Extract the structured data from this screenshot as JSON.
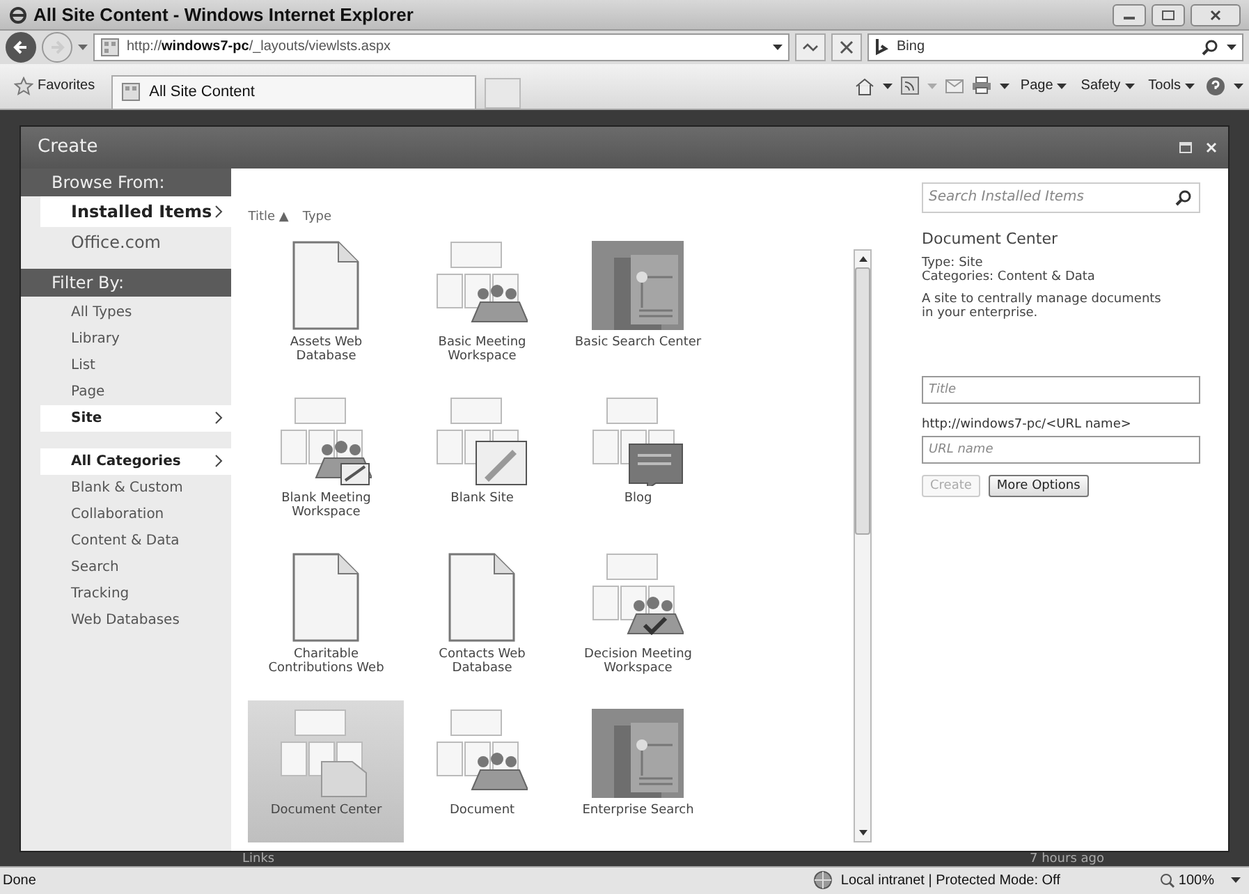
{
  "window": {
    "title": "All Site Content - Windows Internet Explorer"
  },
  "address_bar": {
    "url_prefix": "http://",
    "url_host": "windows7-pc",
    "url_path": "/_layouts/viewlsts.aspx",
    "search_value": "Bing"
  },
  "favorites_bar": {
    "favorites": "Favorites",
    "tab": "All Site Content",
    "commands": [
      "Page",
      "Safety",
      "Tools"
    ]
  },
  "dialog": {
    "title": "Create",
    "browse_header": "Browse From:",
    "browse_items": [
      {
        "label": "Installed Items",
        "selected": true
      },
      {
        "label": "Office.com",
        "selected": false
      }
    ],
    "filter_header": "Filter By:",
    "type_filters": [
      {
        "label": "All Types",
        "selected": false
      },
      {
        "label": "Library",
        "selected": false
      },
      {
        "label": "List",
        "selected": false
      },
      {
        "label": "Page",
        "selected": false
      },
      {
        "label": "Site",
        "selected": true
      }
    ],
    "category_filters": [
      {
        "label": "All Categories",
        "selected": true
      },
      {
        "label": "Blank & Custom",
        "selected": false
      },
      {
        "label": "Collaboration",
        "selected": false
      },
      {
        "label": "Content & Data",
        "selected": false
      },
      {
        "label": "Search",
        "selected": false
      },
      {
        "label": "Tracking",
        "selected": false
      },
      {
        "label": "Web Databases",
        "selected": false
      }
    ],
    "sort": {
      "title": "Title",
      "arrow": "▲",
      "type": "Type"
    },
    "items": [
      {
        "label": "Assets Web Database",
        "kind": "page",
        "selected": false
      },
      {
        "label": "Basic Meeting Workspace",
        "kind": "meeting",
        "selected": false
      },
      {
        "label": "Basic Search Center",
        "kind": "search",
        "selected": false
      },
      {
        "label": "Blank Meeting Workspace",
        "kind": "meeting-edit",
        "selected": false
      },
      {
        "label": "Blank Site",
        "kind": "site-edit",
        "selected": false
      },
      {
        "label": "Blog",
        "kind": "blog",
        "selected": false
      },
      {
        "label": "Charitable Contributions Web",
        "kind": "page",
        "selected": false
      },
      {
        "label": "Contacts Web Database",
        "kind": "page",
        "selected": false
      },
      {
        "label": "Decision Meeting Workspace",
        "kind": "meeting-check",
        "selected": false
      },
      {
        "label": "Document Center",
        "kind": "folder",
        "selected": true
      },
      {
        "label": "Document",
        "kind": "people",
        "selected": false
      },
      {
        "label": "Enterprise Search",
        "kind": "search",
        "selected": false
      }
    ],
    "details": {
      "search_placeholder": "Search Installed Items",
      "name": "Document Center",
      "type": "Type: Site",
      "categories": "Categories: Content & Data",
      "description": "A site to centrally manage documents in your enterprise.",
      "title_placeholder": "Title",
      "url_label": "http://windows7-pc/<URL name>",
      "url_placeholder": "URL name",
      "create": {
        "label": "Create",
        "disabled": true
      },
      "more": {
        "label": "More Options",
        "disabled": false
      }
    }
  },
  "background_page": {
    "link": "Links",
    "time": "7 hours ago"
  },
  "status_bar": {
    "text": "Done",
    "zone": "Local intranet | Protected Mode: Off",
    "zoom": "100%"
  }
}
